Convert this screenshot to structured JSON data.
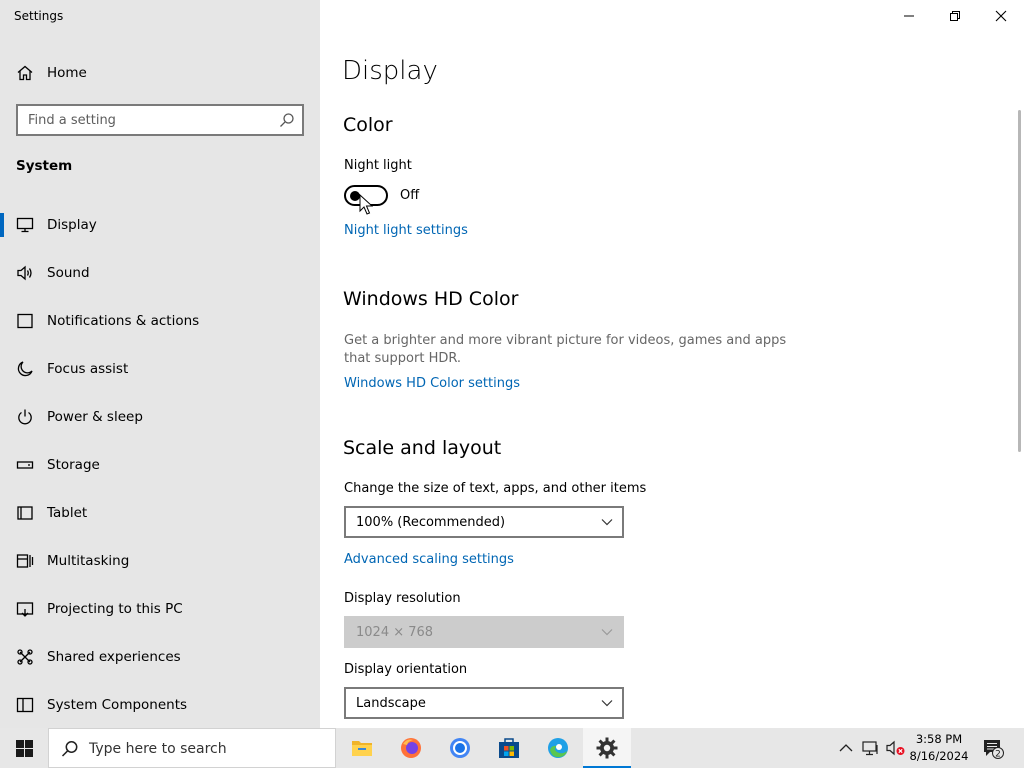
{
  "window": {
    "title": "Settings",
    "minimize_label": "Minimize",
    "maximize_label": "Restore",
    "close_label": "Close"
  },
  "sidebar": {
    "home_label": "Home",
    "search_placeholder": "Find a setting",
    "section_label": "System",
    "items": [
      {
        "label": "Display",
        "icon": "monitor-icon",
        "active": true
      },
      {
        "label": "Sound",
        "icon": "speaker-icon"
      },
      {
        "label": "Notifications & actions",
        "icon": "notification-icon"
      },
      {
        "label": "Focus assist",
        "icon": "moon-icon"
      },
      {
        "label": "Power & sleep",
        "icon": "power-icon"
      },
      {
        "label": "Storage",
        "icon": "storage-icon"
      },
      {
        "label": "Tablet",
        "icon": "tablet-icon"
      },
      {
        "label": "Multitasking",
        "icon": "multitasking-icon"
      },
      {
        "label": "Projecting to this PC",
        "icon": "projector-icon"
      },
      {
        "label": "Shared experiences",
        "icon": "shared-icon"
      },
      {
        "label": "System Components",
        "icon": "components-icon"
      }
    ]
  },
  "main": {
    "title": "Display",
    "color": {
      "heading": "Color",
      "night_light_label": "Night light",
      "night_light_state": "Off",
      "night_light_link": "Night light settings"
    },
    "hd_color": {
      "heading": "Windows HD Color",
      "description": "Get a brighter and more vibrant picture for videos, games and apps that support HDR.",
      "link": "Windows HD Color settings"
    },
    "scale_layout": {
      "heading": "Scale and layout",
      "scale_label": "Change the size of text, apps, and other items",
      "scale_value": "100% (Recommended)",
      "advanced_link": "Advanced scaling settings",
      "resolution_label": "Display resolution",
      "resolution_value": "1024 × 768",
      "orientation_label": "Display orientation",
      "orientation_value": "Landscape"
    }
  },
  "taskbar": {
    "search_placeholder": "Type here to search",
    "apps": [
      "file-explorer-icon",
      "firefox-icon",
      "chrome-icon",
      "store-icon",
      "edge-icon",
      "settings-gear-icon"
    ],
    "time": "3:58 PM",
    "date": "8/16/2024",
    "notification_count": "2"
  },
  "colors": {
    "accent": "#0067c0",
    "link": "#0066b4",
    "sidebar_bg": "#e6e6e6",
    "taskbar_bg": "#e7e7e7"
  }
}
